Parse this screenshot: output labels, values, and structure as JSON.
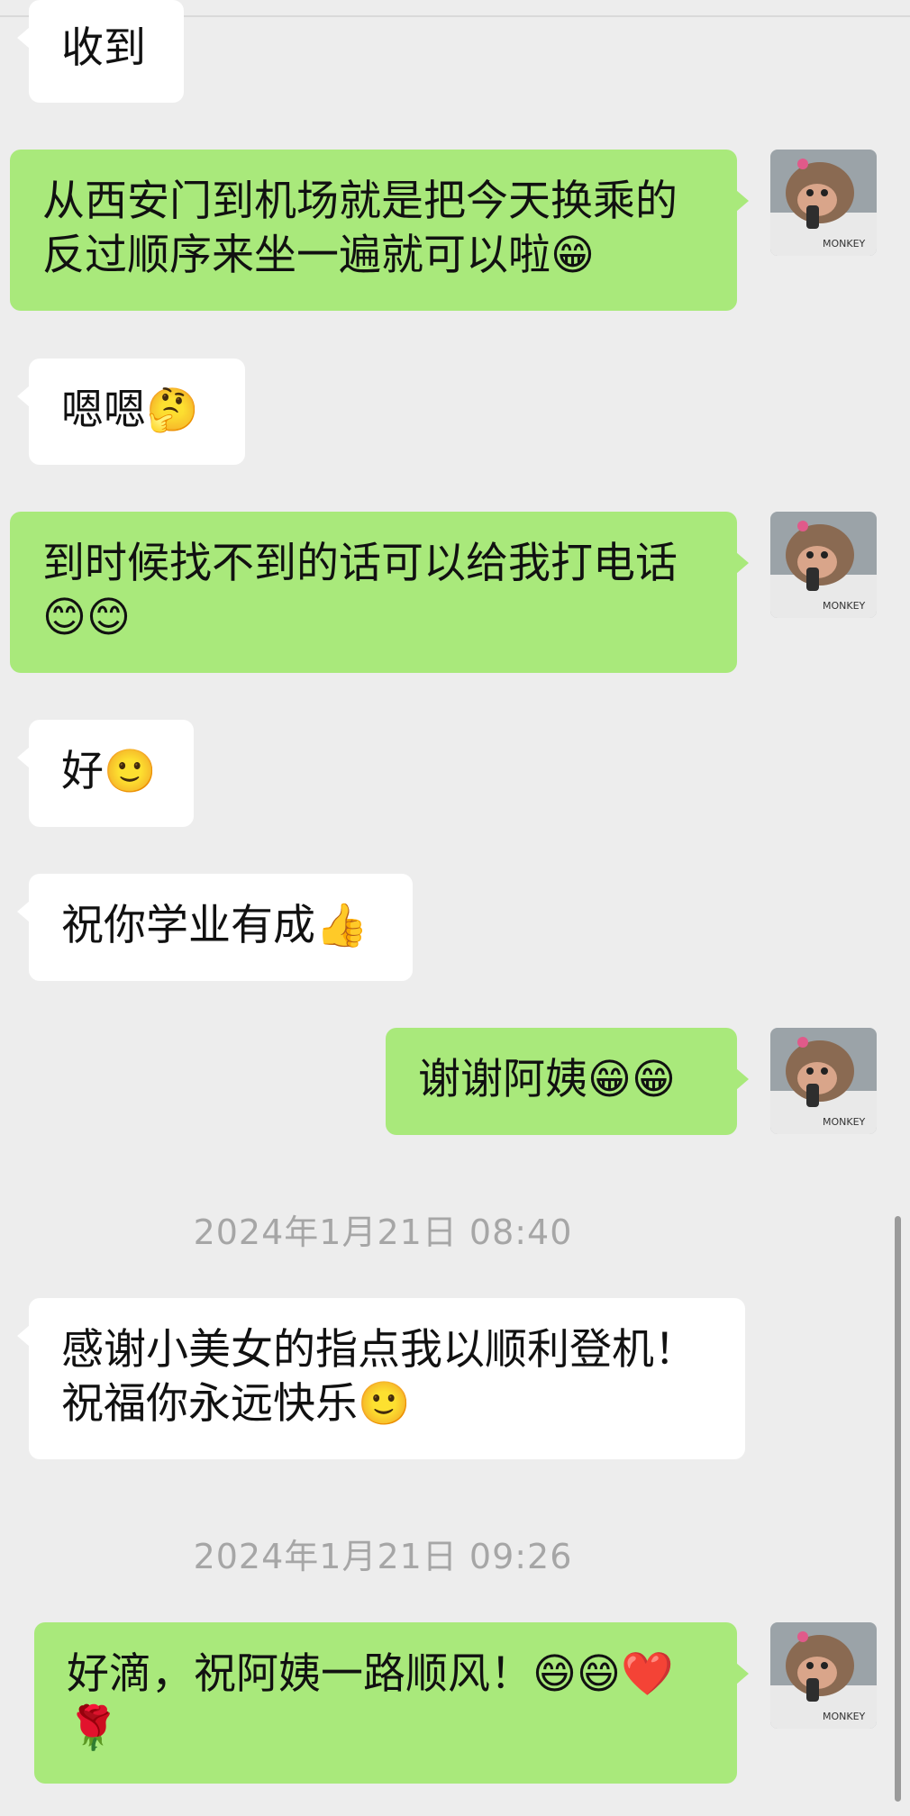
{
  "messages": [
    {
      "text1": "收到"
    },
    {
      "text1": "从西安门到机场就是把今天换乘的",
      "text2": "反过顺序来坐一遍就可以啦😁"
    },
    {
      "text1": "嗯嗯🤔"
    },
    {
      "text1": "到时候找不到的话可以给我打电话",
      "text2": "😊😊"
    },
    {
      "text1": "好🙂"
    },
    {
      "text1": "祝你学业有成👍"
    },
    {
      "text1": "谢谢阿姨😁😁"
    },
    {
      "text1": "感谢小美女的指点我以顺利登机！",
      "text2": "祝福你永远快乐🙂"
    },
    {
      "text1": "好滴，祝阿姨一路顺风！😄😄❤️",
      "text2": "🌹"
    }
  ],
  "timestamps": {
    "t1": "2024年1月21日 08:40",
    "t2": "2024年1月21日 09:26"
  },
  "avatar": {
    "caption": "MONKEY"
  },
  "colors": {
    "background": "#ededed",
    "incoming_bubble": "#ffffff",
    "outgoing_bubble": "#a9e97b",
    "timestamp_text": "#a6a6a6"
  }
}
